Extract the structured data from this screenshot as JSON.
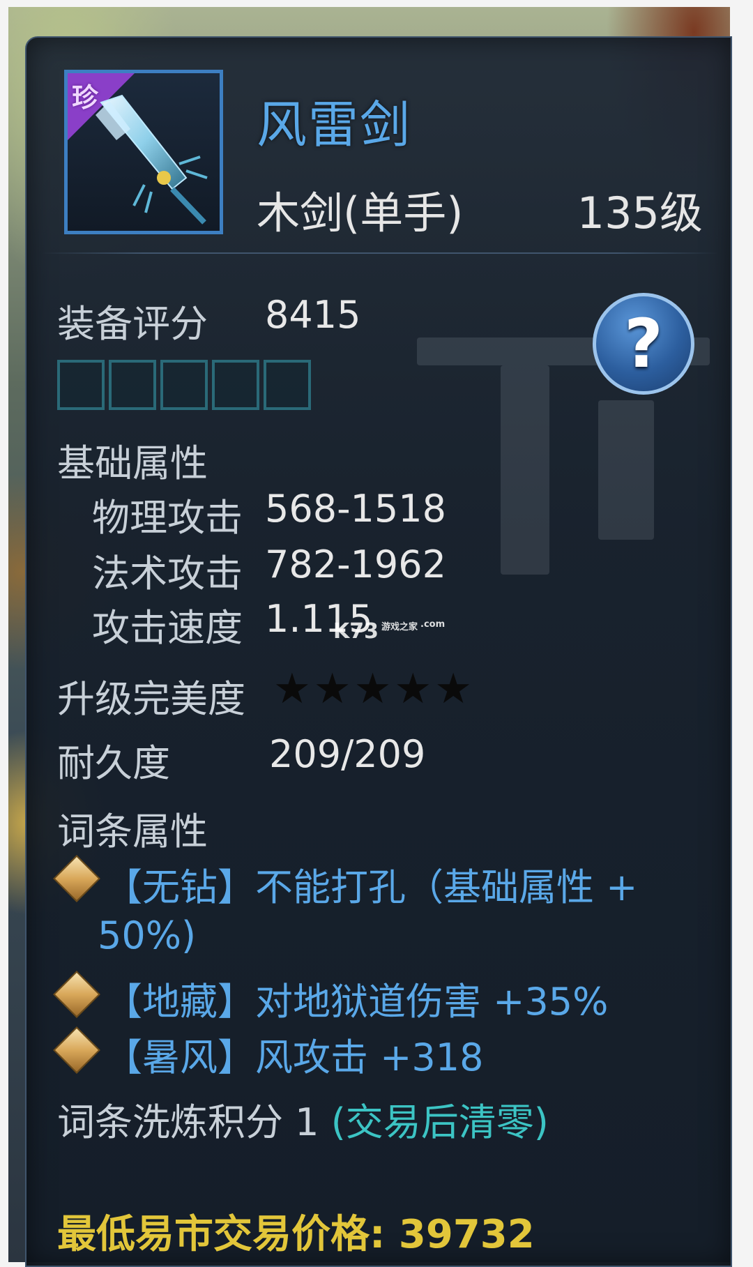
{
  "item": {
    "rarity_badge": "珍",
    "name": "风雷剑",
    "type": "木剑(单手)",
    "level": "135级"
  },
  "score": {
    "label": "装备评分",
    "value": "8415"
  },
  "gem_slots": {
    "count": 5
  },
  "help": {
    "symbol": "?"
  },
  "base_attrs": {
    "title": "基础属性",
    "rows": [
      {
        "name": "物理攻击",
        "value": "568-1518"
      },
      {
        "name": "法术攻击",
        "value": "782-1962"
      },
      {
        "name": "攻击速度",
        "value": "1.115"
      }
    ]
  },
  "perfection": {
    "label": "升级完美度",
    "stars_filled": 0,
    "stars_total": 5
  },
  "durability": {
    "label": "耐久度",
    "value": "209/209"
  },
  "affixes": {
    "title": "词条属性",
    "items": [
      {
        "line1": "【无钻】不能打孔（基础属性 +",
        "line2": "50%)"
      },
      {
        "line1": "【地藏】对地狱道伤害 +35%"
      },
      {
        "line1": "【暑风】风攻击 +318"
      }
    ]
  },
  "wash": {
    "label": "词条洗炼积分 1 ",
    "note": "(交易后清零)"
  },
  "price": {
    "label": "最低易市交易价格: 39732"
  },
  "watermark": {
    "brand": "K73",
    "tag": "游戏之家",
    "domain": ".com"
  },
  "colors": {
    "item_name": "#5aa8e8",
    "affix_text": "#5aa8e8",
    "wash_note": "#3cc4c4",
    "price": "#e2c63a",
    "rare_badge": "#8a3fc8"
  }
}
